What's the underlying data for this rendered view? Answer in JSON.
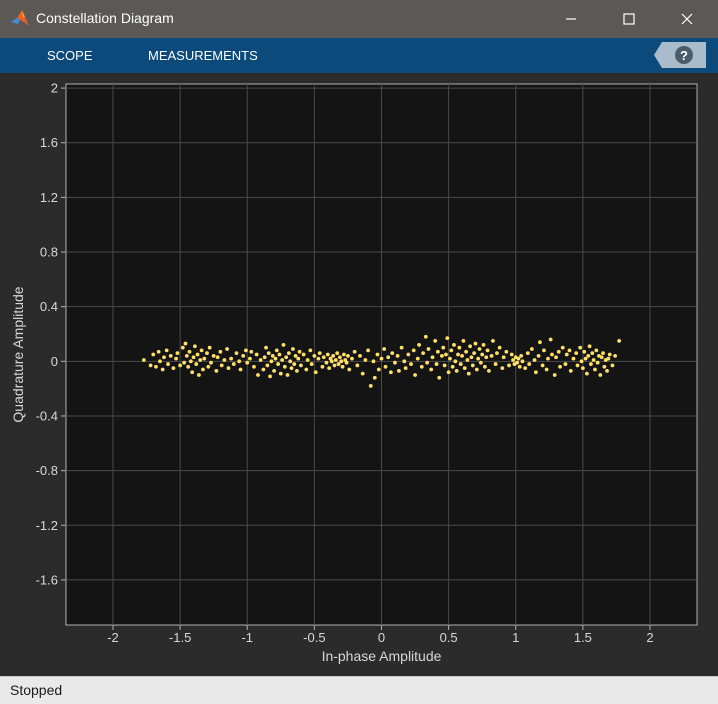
{
  "window": {
    "title": "Constellation Diagram",
    "controls": [
      "minimize-icon",
      "maximize-icon",
      "close-icon"
    ]
  },
  "toolstrip": {
    "tabs": [
      {
        "label": "SCOPE"
      },
      {
        "label": "MEASUREMENTS"
      }
    ],
    "help_icon": "help-icon"
  },
  "status": {
    "text": "Stopped"
  },
  "colors": {
    "titlebar": "#5b5856",
    "toolstrip": "#0b4a7a",
    "plot_background": "#141414",
    "marker": "#ffe066",
    "grid": "#4a4a4a"
  },
  "chart_data": {
    "type": "scatter",
    "xlabel": "In-phase Amplitude",
    "ylabel": "Quadrature Amplitude",
    "xlim": [
      -2.35,
      2.35
    ],
    "ylim": [
      -1.93,
      2.03
    ],
    "x_ticks": [
      -2,
      -1.5,
      -1,
      -0.5,
      0,
      0.5,
      1,
      1.5,
      2
    ],
    "x_tick_labels": [
      "-2",
      "-1.5",
      "-1",
      "-0.5",
      "0",
      "0.5",
      "1",
      "1.5",
      "2"
    ],
    "y_ticks": [
      2,
      1.6,
      1.2,
      0.8,
      0.4,
      0,
      -0.4,
      -0.8,
      -1.2,
      -1.6
    ],
    "y_tick_labels": [
      "2",
      "1.6",
      "1.2",
      "0.8",
      "0.4",
      "0",
      "-0.4",
      "-0.8",
      "-1.2",
      "-1.6"
    ],
    "grid": true,
    "marker_color": "#ffe066",
    "points": [
      [
        -1.77,
        0.01
      ],
      [
        -1.72,
        -0.03
      ],
      [
        -1.7,
        0.05
      ],
      [
        -1.68,
        -0.04
      ],
      [
        -1.66,
        0.07
      ],
      [
        -1.65,
        0.0
      ],
      [
        -1.63,
        -0.06
      ],
      [
        -1.62,
        0.03
      ],
      [
        -1.6,
        0.08
      ],
      [
        -1.59,
        -0.02
      ],
      [
        -1.57,
        0.04
      ],
      [
        -1.55,
        -0.05
      ],
      [
        -1.53,
        0.02
      ],
      [
        -1.52,
        0.06
      ],
      [
        -1.5,
        -0.03
      ],
      [
        -1.48,
        0.1
      ],
      [
        -1.47,
        -0.01
      ],
      [
        -1.46,
        0.13
      ],
      [
        -1.45,
        0.04
      ],
      [
        -1.44,
        -0.04
      ],
      [
        -1.43,
        0.07
      ],
      [
        -1.42,
        0.0
      ],
      [
        -1.41,
        -0.08
      ],
      [
        -1.4,
        0.03
      ],
      [
        -1.39,
        0.11
      ],
      [
        -1.38,
        -0.02
      ],
      [
        -1.37,
        0.05
      ],
      [
        -1.36,
        -0.1
      ],
      [
        -1.35,
        0.01
      ],
      [
        -1.34,
        0.08
      ],
      [
        -1.33,
        -0.06
      ],
      [
        -1.32,
        0.02
      ],
      [
        -1.3,
        0.06
      ],
      [
        -1.29,
        -0.04
      ],
      [
        -1.28,
        0.1
      ],
      [
        -1.27,
        -0.01
      ],
      [
        -1.25,
        0.04
      ],
      [
        -1.23,
        -0.07
      ],
      [
        -1.22,
        0.03
      ],
      [
        -1.2,
        0.07
      ],
      [
        -1.19,
        -0.03
      ],
      [
        -1.17,
        0.01
      ],
      [
        -1.15,
        0.09
      ],
      [
        -1.14,
        -0.05
      ],
      [
        -1.12,
        0.02
      ],
      [
        -1.1,
        -0.02
      ],
      [
        -1.08,
        0.06
      ],
      [
        -1.06,
        0.0
      ],
      [
        -1.05,
        -0.06
      ],
      [
        -1.03,
        0.04
      ],
      [
        -1.01,
        0.08
      ],
      [
        -1.0,
        -0.01
      ],
      [
        -0.98,
        0.02
      ],
      [
        -0.97,
        0.07
      ],
      [
        -0.95,
        -0.04
      ],
      [
        -0.93,
        0.05
      ],
      [
        -0.92,
        -0.1
      ],
      [
        -0.9,
        0.01
      ],
      [
        -0.88,
        -0.06
      ],
      [
        -0.87,
        0.03
      ],
      [
        -0.86,
        0.1
      ],
      [
        -0.85,
        -0.03
      ],
      [
        -0.84,
        0.06
      ],
      [
        -0.83,
        -0.11
      ],
      [
        -0.82,
        0.0
      ],
      [
        -0.81,
        0.04
      ],
      [
        -0.8,
        -0.07
      ],
      [
        -0.79,
        0.02
      ],
      [
        -0.78,
        0.08
      ],
      [
        -0.77,
        -0.02
      ],
      [
        -0.76,
        0.05
      ],
      [
        -0.75,
        -0.09
      ],
      [
        -0.74,
        0.01
      ],
      [
        -0.73,
        0.12
      ],
      [
        -0.72,
        -0.04
      ],
      [
        -0.71,
        0.03
      ],
      [
        -0.7,
        -0.1
      ],
      [
        -0.69,
        0.06
      ],
      [
        -0.68,
        0.0
      ],
      [
        -0.67,
        -0.05
      ],
      [
        -0.66,
        0.09
      ],
      [
        -0.65,
        -0.02
      ],
      [
        -0.64,
        0.04
      ],
      [
        -0.63,
        -0.07
      ],
      [
        -0.62,
        0.02
      ],
      [
        -0.61,
        0.07
      ],
      [
        -0.6,
        -0.03
      ],
      [
        -0.58,
        0.05
      ],
      [
        -0.56,
        -0.06
      ],
      [
        -0.55,
        0.01
      ],
      [
        -0.53,
        0.08
      ],
      [
        -0.52,
        -0.02
      ],
      [
        -0.5,
        0.04
      ],
      [
        -0.49,
        -0.08
      ],
      [
        -0.47,
        0.02
      ],
      [
        -0.46,
        0.06
      ],
      [
        -0.44,
        -0.04
      ],
      [
        -0.43,
        0.03
      ],
      [
        -0.41,
        -0.01
      ],
      [
        -0.4,
        0.05
      ],
      [
        -0.39,
        -0.05
      ],
      [
        -0.38,
        0.02
      ],
      [
        -0.37,
        0.0
      ],
      [
        -0.36,
        0.04
      ],
      [
        -0.35,
        -0.03
      ],
      [
        -0.34,
        0.01
      ],
      [
        -0.33,
        0.06
      ],
      [
        -0.32,
        -0.02
      ],
      [
        -0.31,
        0.03
      ],
      [
        -0.3,
        0.0
      ],
      [
        -0.29,
        -0.04
      ],
      [
        -0.28,
        0.05
      ],
      [
        -0.27,
        0.01
      ],
      [
        -0.26,
        -0.01
      ],
      [
        -0.25,
        0.04
      ],
      [
        -0.24,
        -0.06
      ],
      [
        -0.22,
        0.02
      ],
      [
        -0.2,
        0.07
      ],
      [
        -0.18,
        -0.03
      ],
      [
        -0.16,
        0.04
      ],
      [
        -0.14,
        -0.09
      ],
      [
        -0.12,
        0.01
      ],
      [
        -0.1,
        0.08
      ],
      [
        -0.08,
        -0.18
      ],
      [
        -0.06,
        0.0
      ],
      [
        -0.05,
        -0.12
      ],
      [
        -0.03,
        0.05
      ],
      [
        -0.02,
        -0.06
      ],
      [
        0.0,
        0.02
      ],
      [
        0.02,
        0.09
      ],
      [
        0.03,
        -0.04
      ],
      [
        0.05,
        0.03
      ],
      [
        0.07,
        -0.08
      ],
      [
        0.08,
        0.06
      ],
      [
        0.1,
        -0.01
      ],
      [
        0.12,
        0.04
      ],
      [
        0.13,
        -0.07
      ],
      [
        0.15,
        0.1
      ],
      [
        0.17,
        0.0
      ],
      [
        0.18,
        -0.05
      ],
      [
        0.2,
        0.05
      ],
      [
        0.22,
        -0.02
      ],
      [
        0.24,
        0.08
      ],
      [
        0.25,
        -0.1
      ],
      [
        0.27,
        0.02
      ],
      [
        0.28,
        0.12
      ],
      [
        0.3,
        -0.04
      ],
      [
        0.31,
        0.06
      ],
      [
        0.33,
        0.18
      ],
      [
        0.34,
        -0.01
      ],
      [
        0.35,
        0.09
      ],
      [
        0.37,
        -0.06
      ],
      [
        0.38,
        0.03
      ],
      [
        0.4,
        0.15
      ],
      [
        0.41,
        -0.02
      ],
      [
        0.42,
        0.07
      ],
      [
        0.43,
        -0.12
      ],
      [
        0.45,
        0.04
      ],
      [
        0.46,
        0.1
      ],
      [
        0.47,
        -0.03
      ],
      [
        0.48,
        0.05
      ],
      [
        0.49,
        0.17
      ],
      [
        0.5,
        -0.08
      ],
      [
        0.51,
        0.02
      ],
      [
        0.52,
        0.08
      ],
      [
        0.53,
        -0.04
      ],
      [
        0.54,
        0.12
      ],
      [
        0.55,
        0.0
      ],
      [
        0.56,
        -0.07
      ],
      [
        0.57,
        0.05
      ],
      [
        0.58,
        0.1
      ],
      [
        0.59,
        -0.02
      ],
      [
        0.6,
        0.04
      ],
      [
        0.61,
        0.15
      ],
      [
        0.62,
        -0.05
      ],
      [
        0.63,
        0.07
      ],
      [
        0.64,
        0.01
      ],
      [
        0.65,
        -0.09
      ],
      [
        0.66,
        0.11
      ],
      [
        0.67,
        0.03
      ],
      [
        0.68,
        -0.03
      ],
      [
        0.69,
        0.06
      ],
      [
        0.7,
        0.13
      ],
      [
        0.71,
        -0.06
      ],
      [
        0.72,
        0.02
      ],
      [
        0.73,
        0.09
      ],
      [
        0.74,
        -0.01
      ],
      [
        0.75,
        0.05
      ],
      [
        0.76,
        0.12
      ],
      [
        0.77,
        -0.04
      ],
      [
        0.78,
        0.03
      ],
      [
        0.79,
        0.08
      ],
      [
        0.8,
        -0.07
      ],
      [
        0.82,
        0.04
      ],
      [
        0.83,
        0.15
      ],
      [
        0.85,
        -0.02
      ],
      [
        0.86,
        0.06
      ],
      [
        0.88,
        0.1
      ],
      [
        0.9,
        -0.05
      ],
      [
        0.91,
        0.03
      ],
      [
        0.93,
        0.07
      ],
      [
        0.95,
        -0.03
      ],
      [
        0.97,
        0.05
      ],
      [
        0.98,
        0.01
      ],
      [
        0.99,
        -0.02
      ],
      [
        1.0,
        0.03
      ],
      [
        1.01,
        -0.01
      ],
      [
        1.02,
        0.02
      ],
      [
        1.03,
        -0.04
      ],
      [
        1.04,
        0.04
      ],
      [
        1.05,
        0.0
      ],
      [
        1.07,
        -0.05
      ],
      [
        1.09,
        0.06
      ],
      [
        1.1,
        -0.02
      ],
      [
        1.12,
        0.09
      ],
      [
        1.14,
        0.01
      ],
      [
        1.15,
        -0.08
      ],
      [
        1.17,
        0.04
      ],
      [
        1.18,
        0.14
      ],
      [
        1.2,
        -0.03
      ],
      [
        1.21,
        0.08
      ],
      [
        1.23,
        -0.06
      ],
      [
        1.24,
        0.02
      ],
      [
        1.26,
        0.16
      ],
      [
        1.27,
        0.05
      ],
      [
        1.29,
        -0.1
      ],
      [
        1.3,
        0.03
      ],
      [
        1.32,
        0.07
      ],
      [
        1.33,
        -0.04
      ],
      [
        1.35,
        0.1
      ],
      [
        1.37,
        -0.02
      ],
      [
        1.38,
        0.05
      ],
      [
        1.4,
        0.08
      ],
      [
        1.41,
        -0.07
      ],
      [
        1.43,
        0.02
      ],
      [
        1.45,
        0.06
      ],
      [
        1.46,
        -0.03
      ],
      [
        1.48,
        0.1
      ],
      [
        1.49,
        0.0
      ],
      [
        1.5,
        -0.05
      ],
      [
        1.51,
        0.07
      ],
      [
        1.52,
        0.02
      ],
      [
        1.53,
        -0.09
      ],
      [
        1.54,
        0.04
      ],
      [
        1.55,
        0.11
      ],
      [
        1.56,
        -0.02
      ],
      [
        1.57,
        0.06
      ],
      [
        1.58,
        0.01
      ],
      [
        1.59,
        -0.06
      ],
      [
        1.6,
        0.08
      ],
      [
        1.61,
        -0.01
      ],
      [
        1.62,
        0.04
      ],
      [
        1.63,
        -0.1
      ],
      [
        1.64,
        0.03
      ],
      [
        1.65,
        0.06
      ],
      [
        1.66,
        -0.04
      ],
      [
        1.67,
        0.01
      ],
      [
        1.68,
        -0.07
      ],
      [
        1.69,
        0.02
      ],
      [
        1.7,
        0.05
      ],
      [
        1.72,
        -0.03
      ],
      [
        1.74,
        0.04
      ],
      [
        1.77,
        0.15
      ]
    ]
  }
}
